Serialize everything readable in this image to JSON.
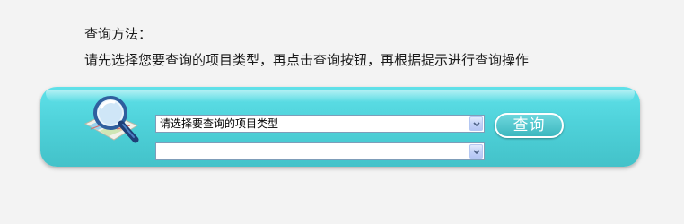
{
  "instructions": {
    "heading": "查询方法：",
    "body": "请先选择您要查询的项目类型，再点击查询按钮，再根据提示进行查询操作"
  },
  "search_panel": {
    "project_type_select": {
      "selected": "请选择要查询的项目类型"
    },
    "sub_select": {
      "selected": ""
    },
    "query_button_label": "查询"
  },
  "icons": {
    "search_graphic": "magnifier-over-map-icon",
    "dropdown_arrow": "chevron-down-icon"
  },
  "colors": {
    "panel_top": "#5fe1e9",
    "panel_bottom": "#43c2c9",
    "select_border": "#7f9db9",
    "button": "#3cb7bf"
  }
}
